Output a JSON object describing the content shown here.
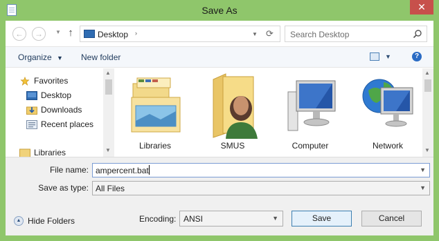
{
  "window": {
    "title": "Save As",
    "close_glyph": "✕",
    "title_icon": "notepad-icon"
  },
  "nav": {
    "back_glyph": "←",
    "forward_glyph": "→",
    "dropdown_glyph": "▼",
    "up_glyph": "↑",
    "address": {
      "location": "Desktop",
      "separator": "›",
      "dropdown_glyph": "▼",
      "refresh_glyph": "⟳",
      "icon": "desktop-icon"
    },
    "search_placeholder": "Search Desktop"
  },
  "toolbar": {
    "organize_label": "Organize",
    "organize_glyph": "▼",
    "new_folder_label": "New folder",
    "view_glyph": "▼",
    "help_glyph": "?"
  },
  "sidebar": {
    "items": [
      {
        "label": "Favorites",
        "icon": "star-icon"
      },
      {
        "label": "Desktop",
        "icon": "desktop-icon"
      },
      {
        "label": "Downloads",
        "icon": "downloads-icon"
      },
      {
        "label": "Recent places",
        "icon": "recent-places-icon"
      },
      {
        "label": "Libraries",
        "icon": "libraries-icon"
      }
    ],
    "scroll_up": "▲",
    "scroll_down": "▼"
  },
  "files": {
    "items": [
      {
        "label": "Libraries",
        "icon": "libraries-icon"
      },
      {
        "label": "SMUS",
        "icon": "user-folder-icon"
      },
      {
        "label": "Computer",
        "icon": "computer-icon"
      },
      {
        "label": "Network",
        "icon": "network-icon"
      }
    ],
    "scroll_up": "▲",
    "scroll_down": "▼"
  },
  "form": {
    "file_name_label": "File name:",
    "file_name_value": "ampercent.bat",
    "save_type_label": "Save as type:",
    "save_type_value": "All Files",
    "dropdown_glyph": "▼"
  },
  "footer": {
    "hide_folders_label": "Hide Folders",
    "hide_folders_glyph": "▲",
    "encoding_label": "Encoding:",
    "encoding_value": "ANSI",
    "dropdown_glyph": "▼",
    "save_label": "Save",
    "cancel_label": "Cancel"
  },
  "colors": {
    "frame": "#8fc66b",
    "close": "#c7504b",
    "toolbar": "#f4f7fb",
    "panel": "#f0f0f0",
    "focus_border": "#7a9cd3",
    "default_button": "#3c7fb1"
  }
}
